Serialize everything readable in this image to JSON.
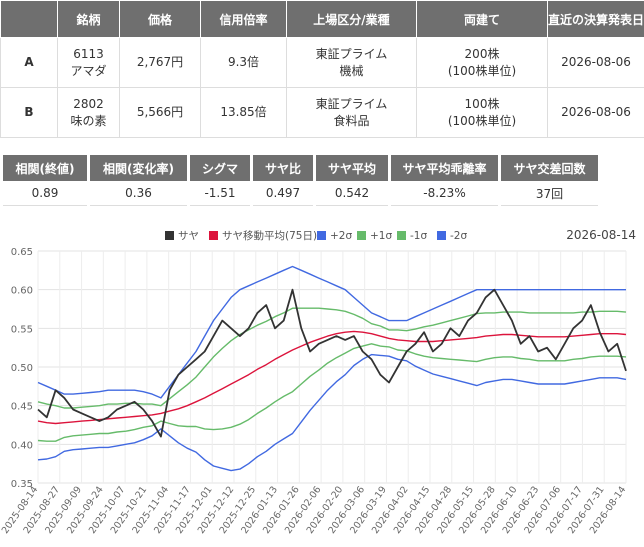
{
  "stock_table": {
    "headers": [
      "",
      "銘柄",
      "価格",
      "信用倍率",
      "上場区分/業種",
      "両建て",
      "直近の決算発表日"
    ],
    "rows": [
      {
        "label": "A",
        "name_code": "6113",
        "name": "アマダ",
        "price": "2,767円",
        "margin_ratio": "9.3倍",
        "market": "東証プライム",
        "industry": "機械",
        "hedge_qty": "200株",
        "hedge_unit": "(100株単位)",
        "earnings_date": "2026-08-06"
      },
      {
        "label": "B",
        "name_code": "2802",
        "name": "味の素",
        "price": "5,566円",
        "margin_ratio": "13.85倍",
        "market": "東証プライム",
        "industry": "食料品",
        "hedge_qty": "100株",
        "hedge_unit": "(100株単位)",
        "earnings_date": "2026-08-06"
      }
    ]
  },
  "stats": {
    "headers": [
      "相関(終値)",
      "相関(変化率)",
      "シグマ",
      "サヤ比",
      "サヤ平均",
      "サヤ平均乖離率",
      "サヤ交差回数"
    ],
    "values": [
      "0.89",
      "0.36",
      "-1.51",
      "0.497",
      "0.542",
      "-8.23%",
      "37回"
    ]
  },
  "chart_data": {
    "type": "line",
    "date_label": "2026-08-14",
    "ylim": [
      0.35,
      0.65
    ],
    "yticks": [
      "0.65",
      "0.60",
      "0.55",
      "0.50",
      "0.45",
      "0.40",
      "0.35"
    ],
    "xticks": [
      "2025-08-14",
      "2025-08-27",
      "2025-09-09",
      "2025-09-24",
      "2025-10-07",
      "2025-10-21",
      "2025-11-04",
      "2025-11-17",
      "2025-12-01",
      "2025-12-12",
      "2025-12-25",
      "2026-01-13",
      "2026-01-26",
      "2026-02-06",
      "2026-02-20",
      "2026-03-06",
      "2026-03-19",
      "2026-04-02",
      "2026-04-15",
      "2026-04-28",
      "2026-05-15",
      "2026-05-28",
      "2026-06-10",
      "2026-06-23",
      "2026-07-06",
      "2026-07-17",
      "2026-07-31",
      "2026-08-14"
    ],
    "legend": [
      {
        "name": "サヤ",
        "color": "#333333"
      },
      {
        "name": "サヤ移動平均(75日)",
        "color": "#dc143c"
      },
      {
        "name": "+2σ",
        "color": "#4169e1"
      },
      {
        "name": "+1σ",
        "color": "#66bb6a"
      },
      {
        "name": "-1σ",
        "color": "#66bb6a"
      },
      {
        "name": "-2σ",
        "color": "#4169e1"
      }
    ],
    "series": [
      {
        "name": "サヤ",
        "color": "#333333",
        "values": [
          0.445,
          0.435,
          0.47,
          0.46,
          0.445,
          0.44,
          0.435,
          0.43,
          0.435,
          0.445,
          0.45,
          0.455,
          0.445,
          0.43,
          0.41,
          0.47,
          0.49,
          0.5,
          0.51,
          0.52,
          0.54,
          0.56,
          0.55,
          0.54,
          0.55,
          0.57,
          0.58,
          0.55,
          0.56,
          0.6,
          0.55,
          0.52,
          0.53,
          0.535,
          0.54,
          0.535,
          0.54,
          0.52,
          0.51,
          0.49,
          0.48,
          0.5,
          0.52,
          0.53,
          0.545,
          0.52,
          0.53,
          0.55,
          0.54,
          0.56,
          0.57,
          0.59,
          0.6,
          0.58,
          0.56,
          0.53,
          0.54,
          0.52,
          0.525,
          0.51,
          0.53,
          0.55,
          0.56,
          0.58,
          0.545,
          0.52,
          0.53,
          0.495
        ]
      },
      {
        "name": "サヤ移動平均(75日)",
        "color": "#dc143c",
        "values": [
          0.43,
          0.428,
          0.427,
          0.428,
          0.429,
          0.43,
          0.431,
          0.432,
          0.433,
          0.434,
          0.435,
          0.436,
          0.437,
          0.438,
          0.44,
          0.443,
          0.446,
          0.45,
          0.455,
          0.46,
          0.466,
          0.472,
          0.478,
          0.484,
          0.49,
          0.497,
          0.503,
          0.51,
          0.516,
          0.522,
          0.527,
          0.532,
          0.536,
          0.54,
          0.543,
          0.545,
          0.546,
          0.545,
          0.543,
          0.54,
          0.537,
          0.535,
          0.534,
          0.533,
          0.533,
          0.533,
          0.534,
          0.535,
          0.536,
          0.537,
          0.538,
          0.54,
          0.541,
          0.542,
          0.542,
          0.541,
          0.54,
          0.539,
          0.539,
          0.539,
          0.539,
          0.54,
          0.541,
          0.542,
          0.543,
          0.543,
          0.543,
          0.542
        ]
      },
      {
        "name": "+2σ",
        "color": "#4169e1",
        "values": [
          0.48,
          0.475,
          0.47,
          0.465,
          0.465,
          0.466,
          0.467,
          0.468,
          0.47,
          0.47,
          0.47,
          0.47,
          0.468,
          0.465,
          0.46,
          0.475,
          0.49,
          0.505,
          0.52,
          0.54,
          0.56,
          0.575,
          0.59,
          0.6,
          0.605,
          0.61,
          0.615,
          0.62,
          0.625,
          0.63,
          0.625,
          0.62,
          0.615,
          0.61,
          0.605,
          0.6,
          0.59,
          0.58,
          0.57,
          0.565,
          0.56,
          0.56,
          0.56,
          0.565,
          0.57,
          0.575,
          0.58,
          0.585,
          0.59,
          0.595,
          0.6,
          0.6,
          0.6,
          0.6,
          0.6,
          0.6,
          0.6,
          0.6,
          0.6,
          0.6,
          0.6,
          0.6,
          0.6,
          0.6,
          0.6,
          0.6,
          0.6,
          0.6
        ]
      },
      {
        "name": "+1σ",
        "color": "#66bb6a",
        "values": [
          0.455,
          0.452,
          0.45,
          0.447,
          0.447,
          0.448,
          0.449,
          0.45,
          0.452,
          0.452,
          0.453,
          0.453,
          0.452,
          0.452,
          0.45,
          0.459,
          0.468,
          0.477,
          0.487,
          0.5,
          0.513,
          0.524,
          0.534,
          0.542,
          0.548,
          0.554,
          0.559,
          0.565,
          0.57,
          0.576,
          0.576,
          0.576,
          0.576,
          0.575,
          0.574,
          0.572,
          0.568,
          0.563,
          0.556,
          0.553,
          0.548,
          0.548,
          0.547,
          0.549,
          0.552,
          0.554,
          0.557,
          0.56,
          0.563,
          0.566,
          0.569,
          0.57,
          0.57,
          0.571,
          0.571,
          0.571,
          0.57,
          0.57,
          0.57,
          0.57,
          0.57,
          0.57,
          0.571,
          0.571,
          0.572,
          0.572,
          0.572,
          0.571
        ]
      },
      {
        "name": "-1σ",
        "color": "#66bb6a",
        "values": [
          0.405,
          0.404,
          0.404,
          0.409,
          0.411,
          0.412,
          0.413,
          0.414,
          0.414,
          0.416,
          0.417,
          0.419,
          0.422,
          0.424,
          0.43,
          0.427,
          0.424,
          0.423,
          0.423,
          0.42,
          0.419,
          0.42,
          0.422,
          0.426,
          0.432,
          0.44,
          0.447,
          0.455,
          0.462,
          0.468,
          0.478,
          0.488,
          0.496,
          0.505,
          0.512,
          0.518,
          0.524,
          0.527,
          0.53,
          0.527,
          0.526,
          0.522,
          0.521,
          0.517,
          0.514,
          0.512,
          0.511,
          0.51,
          0.509,
          0.508,
          0.507,
          0.51,
          0.512,
          0.513,
          0.513,
          0.511,
          0.51,
          0.508,
          0.508,
          0.508,
          0.508,
          0.51,
          0.511,
          0.513,
          0.514,
          0.514,
          0.514,
          0.513
        ]
      },
      {
        "name": "-2σ",
        "color": "#4169e1",
        "values": [
          0.38,
          0.381,
          0.384,
          0.391,
          0.393,
          0.394,
          0.395,
          0.396,
          0.396,
          0.398,
          0.4,
          0.402,
          0.406,
          0.411,
          0.42,
          0.411,
          0.402,
          0.395,
          0.39,
          0.38,
          0.372,
          0.369,
          0.366,
          0.368,
          0.375,
          0.384,
          0.391,
          0.4,
          0.407,
          0.414,
          0.429,
          0.444,
          0.457,
          0.47,
          0.481,
          0.49,
          0.502,
          0.51,
          0.516,
          0.515,
          0.514,
          0.51,
          0.508,
          0.501,
          0.496,
          0.491,
          0.488,
          0.485,
          0.482,
          0.479,
          0.476,
          0.48,
          0.482,
          0.484,
          0.484,
          0.482,
          0.48,
          0.478,
          0.478,
          0.478,
          0.478,
          0.48,
          0.482,
          0.484,
          0.486,
          0.486,
          0.486,
          0.484
        ]
      }
    ]
  }
}
